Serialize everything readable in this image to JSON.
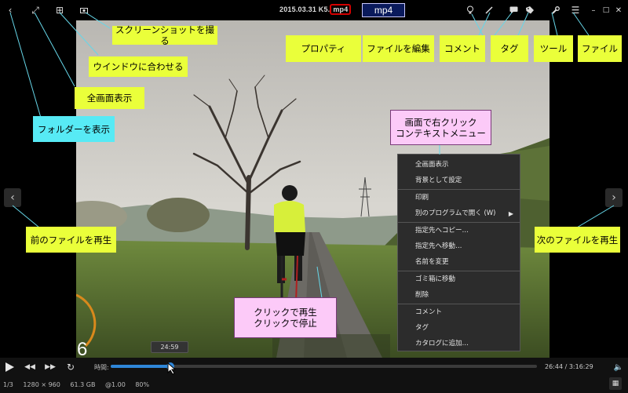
{
  "title": {
    "name": "2015.03.31 K5",
    "ext": "mp4",
    "badge": "mp4"
  },
  "toolbar": {
    "back_icon": "chevron-left-icon",
    "fullscreen_icon": "expand-icon",
    "fit_icon": "fit-window-icon",
    "screenshot_icon": "camera-icon",
    "right_icons": [
      "lightbulb-icon",
      "pen-icon",
      "comment-icon",
      "tag-icon",
      "wrench-icon",
      "menu-icon"
    ]
  },
  "annotations": {
    "screenshot": "スクリーンショットを撮る",
    "fit_window": "ウインドウに合わせる",
    "fullscreen": "全画面表示",
    "show_folder": "フォルダーを表示",
    "properties": "プロパティ",
    "edit_file": "ファイルを編集",
    "comment": "コメント",
    "tag": "タグ",
    "tool": "ツール",
    "file": "ファイル",
    "prev_file": "前のファイルを再生",
    "next_file": "次のファイルを再生",
    "click_play_1": "クリックで再生",
    "click_play_2": "クリックで停止",
    "ctx_title_1": "画面で右クリック",
    "ctx_title_2": "コンテキストメニュー"
  },
  "context_menu": {
    "groups": [
      [
        "全画面表示",
        "背景として設定"
      ],
      [
        "印刷",
        "別のプログラムで開く (W)"
      ],
      [
        "指定先へコピー…",
        "指定先へ移動…",
        "名前を変更"
      ],
      [
        "ゴミ箱に移動",
        "削除"
      ],
      [
        "コメント",
        "タグ",
        "カタログに追加…"
      ]
    ]
  },
  "overlay_number": "6",
  "player": {
    "time_label": "時間:",
    "tooltip": "24:59",
    "progress": 0.14,
    "time_readout": "26:44 / 3:16:29"
  },
  "status": {
    "index": "1/3",
    "resolution": "1280 × 960",
    "size": "61.3 GB",
    "speed": "@1.00",
    "zoom": "80%"
  },
  "colors": {
    "accent": "#2f86d8",
    "callout_yellow": "#eaff3a",
    "callout_cyan": "#57eaf5",
    "callout_pink": "#fccaf8",
    "badge_bg": "#0a1a5c",
    "ext_highlight": "#d40000"
  }
}
